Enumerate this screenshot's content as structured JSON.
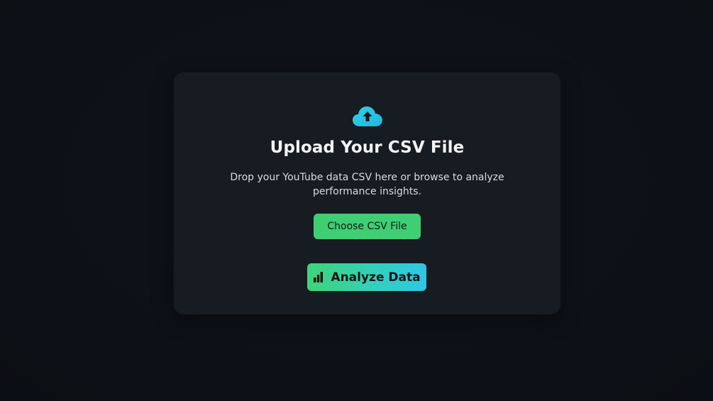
{
  "upload": {
    "title": "Upload Your CSV File",
    "description": "Drop your YouTube data CSV here or browse to analyze performance insights.",
    "choose_button_label": "Choose CSV File",
    "analyze_button_label": "Analyze Data",
    "icons": {
      "upload": "cloud-upload-icon",
      "analyze": "bar-chart-icon"
    }
  },
  "colors": {
    "background": "#0e1117",
    "card": "#171b22",
    "accent_green": "#3fce74",
    "accent_cyan": "#2fc6e6"
  }
}
